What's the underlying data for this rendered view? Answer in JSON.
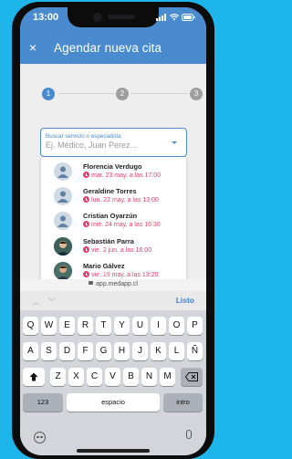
{
  "status_bar": {
    "time": "13:00",
    "icons": [
      "cellular-signal-icon",
      "wifi-icon",
      "battery-icon"
    ]
  },
  "header": {
    "close_icon": "×",
    "title": "Agendar nueva cita",
    "background": "#4a8bcf"
  },
  "stepper": {
    "steps": [
      "1",
      "2",
      "3"
    ],
    "active_step": 1
  },
  "search": {
    "label": "Buscar servicio o especialista",
    "placeholder": "Ej. Médico, Juan Perez..."
  },
  "results": [
    {
      "name": "Florencia Verdugo",
      "date": "mar. 23 may. a las 17:00",
      "avatar": "generic"
    },
    {
      "name": "Geraldine Torres",
      "date": "lun. 22 may. a las 13:00",
      "avatar": "generic"
    },
    {
      "name": "Cristian Oyarzún",
      "date": "mié. 24 may. a las 16:30",
      "avatar": "generic"
    },
    {
      "name": "Sebastián Parra",
      "date": "vie. 2 jun. a las 16:00",
      "avatar": "photo"
    },
    {
      "name": "Mario Gálvez",
      "date": "vie. 19 may. a las 13:20",
      "avatar": "photo"
    }
  ],
  "browser": {
    "url": "app.medapp.cl"
  },
  "keyboard": {
    "toolbar_prev": "︿",
    "toolbar_next": "﹀",
    "done_label": "Listo",
    "row1": [
      "Q",
      "W",
      "E",
      "R",
      "T",
      "Y",
      "U",
      "I",
      "O",
      "P"
    ],
    "row2": [
      "A",
      "S",
      "D",
      "F",
      "G",
      "H",
      "J",
      "K",
      "L",
      "Ñ"
    ],
    "row3": [
      "Z",
      "X",
      "C",
      "V",
      "B",
      "N",
      "M"
    ],
    "numbers_label": "123",
    "space_label": "espacio",
    "return_label": "intro"
  },
  "colors": {
    "accent": "#4a8bcf",
    "date": "#e53e6d",
    "background": "#1eb5ea"
  }
}
